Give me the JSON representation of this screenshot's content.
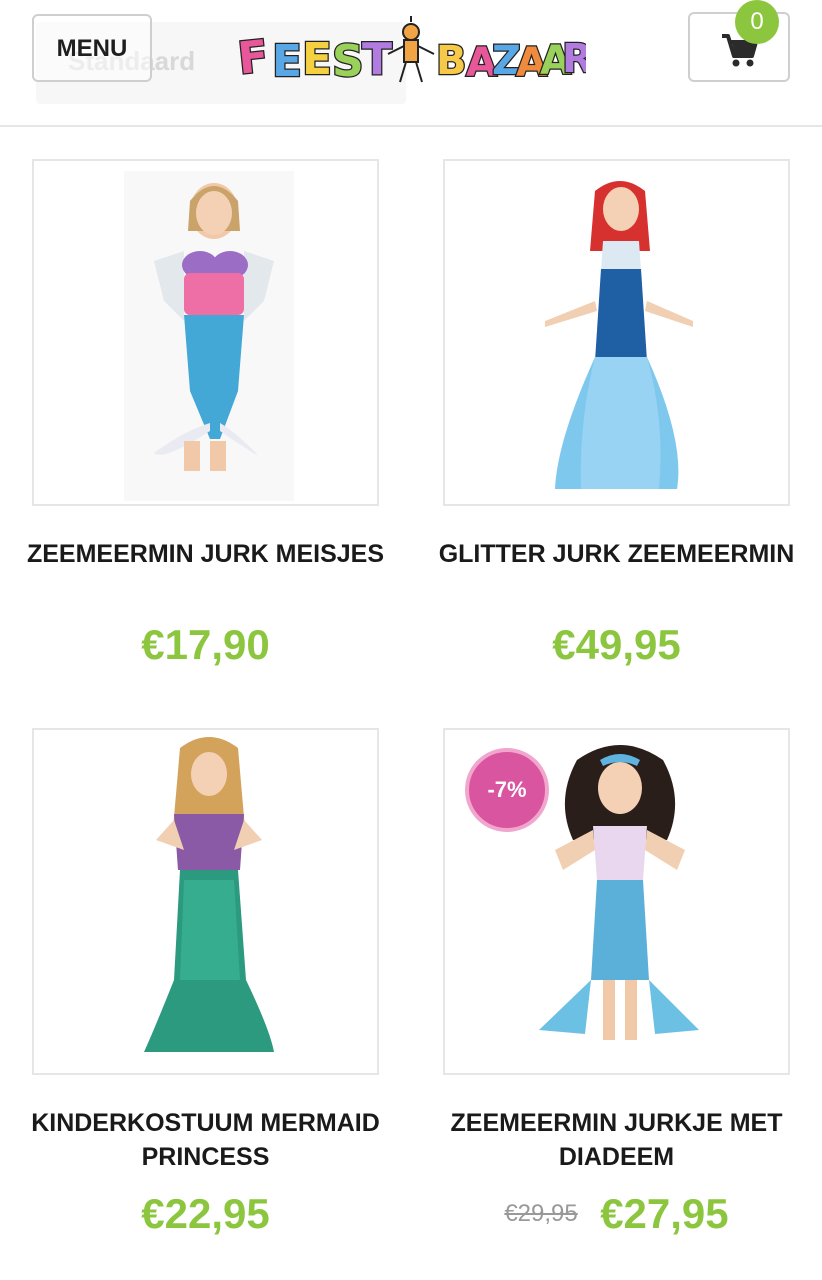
{
  "header": {
    "menu_label": "MENU",
    "sort_ghost_text": "Standaard",
    "logo_text": "FEEST BAZAAR",
    "cart_count": "0"
  },
  "colors": {
    "price_green": "#8cc63f",
    "discount_pink": "#d9559f",
    "border_gray": "#e6e6e6"
  },
  "products": [
    {
      "name": "ZEEMEERMIN JURK MEISJES",
      "price": "€17,90",
      "image": "girl-mermaid-pink-top-costume"
    },
    {
      "name": "GLITTER JURK ZEEMEERMIN",
      "price": "€49,95",
      "image": "woman-blue-sequin-mermaid-dress"
    },
    {
      "name": "KINDERKOSTUUM MERMAID PRINCESS",
      "price": "€22,95",
      "image": "girl-purple-green-mermaid-costume"
    },
    {
      "name": "ZEEMEERMIN JURKJE MET DIADEEM",
      "price": "€27,95",
      "old_price": "€29,95",
      "discount": "-7%",
      "image": "girl-blue-mermaid-dress-diadem"
    }
  ]
}
